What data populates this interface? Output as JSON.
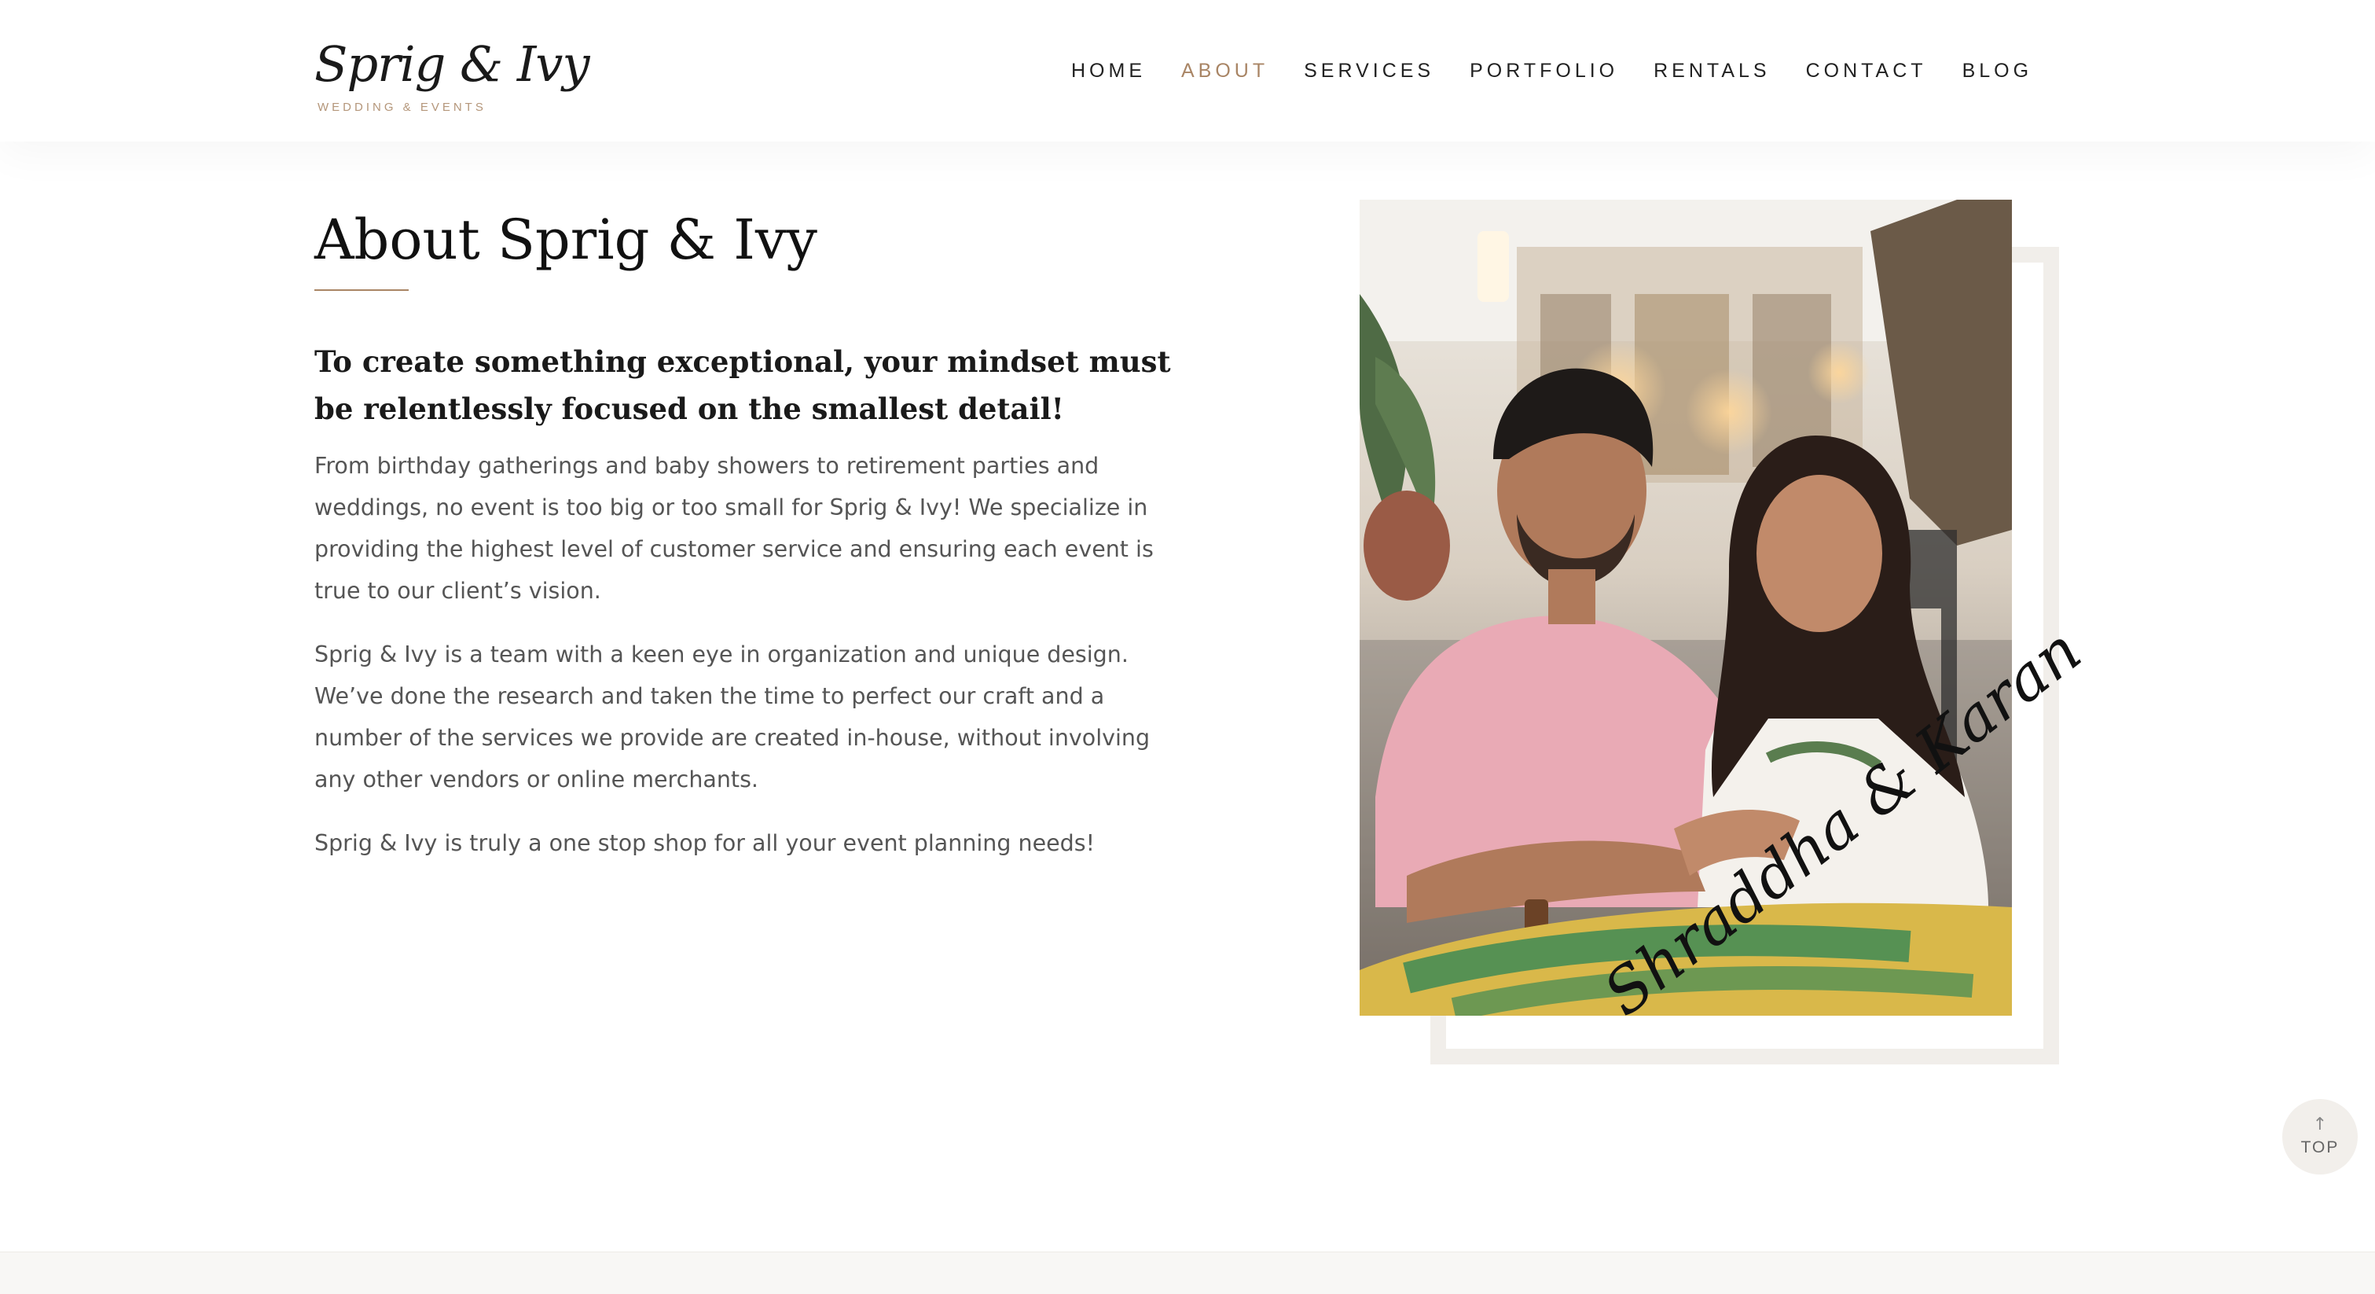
{
  "header": {
    "logo": {
      "script": "Sprig & Ivy",
      "subtitle": "WEDDING & EVENTS"
    },
    "nav": [
      {
        "label": "HOME",
        "active": false
      },
      {
        "label": "ABOUT",
        "active": true
      },
      {
        "label": "SERVICES",
        "active": false
      },
      {
        "label": "PORTFOLIO",
        "active": false
      },
      {
        "label": "RENTALS",
        "active": false
      },
      {
        "label": "CONTACT",
        "active": false
      },
      {
        "label": "BLOG",
        "active": false
      }
    ]
  },
  "main": {
    "title": "About Sprig & Ivy",
    "tagline": "To create something exceptional, your mindset must be relentlessly focused on the smallest detail!",
    "paragraphs": [
      "From birthday gatherings and baby showers to retirement parties and weddings, no event is too big or too small for Sprig & Ivy! We specialize in providing the highest level of customer service and ensuring each event is true to our client’s vision.",
      "Sprig & Ivy is a team with a keen eye in organization and unique design. We’ve done the research and taken the time to perfect our craft and a number of the services we provide are created in-house, without involving any other vendors or online merchants.",
      "Sprig & Ivy is truly a one stop shop for all your event planning needs!"
    ],
    "photo_signature": "Shraddha & Karan"
  },
  "back_to_top": {
    "arrow_icon": "arrow-up-icon",
    "label": "TOP"
  },
  "colors": {
    "accent": "#a98565",
    "frame": "#f1eeea",
    "text_body": "#555555",
    "text_heading": "#111111"
  }
}
